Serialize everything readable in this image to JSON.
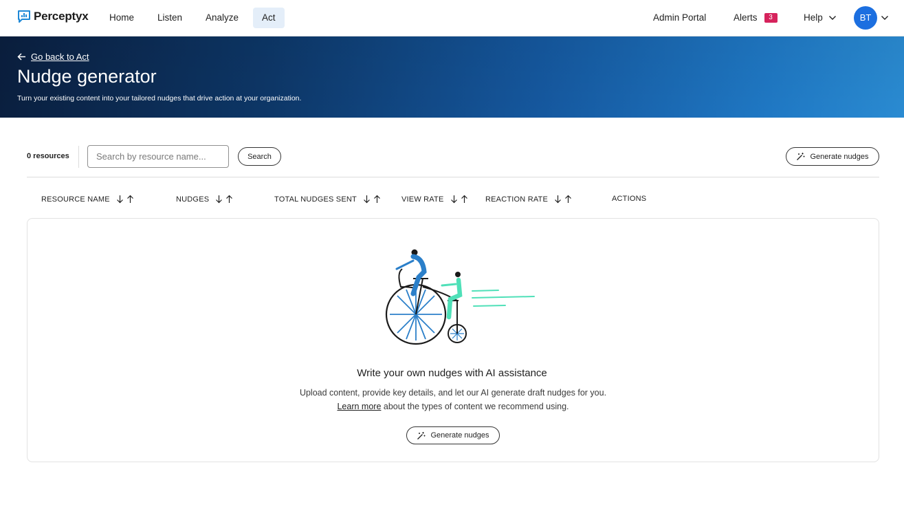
{
  "brand": {
    "name": "Perceptyx",
    "accent": "#1c6fe0",
    "badge_color": "#d6235c"
  },
  "nav": {
    "items": [
      {
        "label": "Home",
        "active": false
      },
      {
        "label": "Listen",
        "active": false
      },
      {
        "label": "Analyze",
        "active": false
      },
      {
        "label": "Act",
        "active": true
      }
    ],
    "admin_portal": "Admin Portal",
    "alerts_label": "Alerts",
    "alerts_count": "3",
    "help_label": "Help",
    "avatar_initials": "BT"
  },
  "banner": {
    "back_link": "Go back to Act",
    "title": "Nudge generator",
    "subtitle": "Turn your existing content into your tailored nudges that drive action at your organization."
  },
  "toolbar": {
    "resource_count": "0 resources",
    "search_placeholder": "Search by resource name...",
    "search_value": "",
    "search_button": "Search",
    "generate_button": "Generate nudges"
  },
  "table": {
    "columns": [
      {
        "label": "RESOURCE NAME",
        "sortable": true
      },
      {
        "label": "NUDGES",
        "sortable": true
      },
      {
        "label": "TOTAL NUDGES SENT",
        "sortable": true
      },
      {
        "label": "VIEW RATE",
        "sortable": true
      },
      {
        "label": "REACTION RATE",
        "sortable": true
      },
      {
        "label": "ACTIONS",
        "sortable": false
      }
    ],
    "rows": []
  },
  "empty_state": {
    "title": "Write your own nudges with AI assistance",
    "text_before": "Upload content, provide key details, and let our AI generate draft nudges for you.",
    "learn_more": "Learn more",
    "text_after": "about the types of content we recommend using.",
    "button": "Generate nudges"
  }
}
